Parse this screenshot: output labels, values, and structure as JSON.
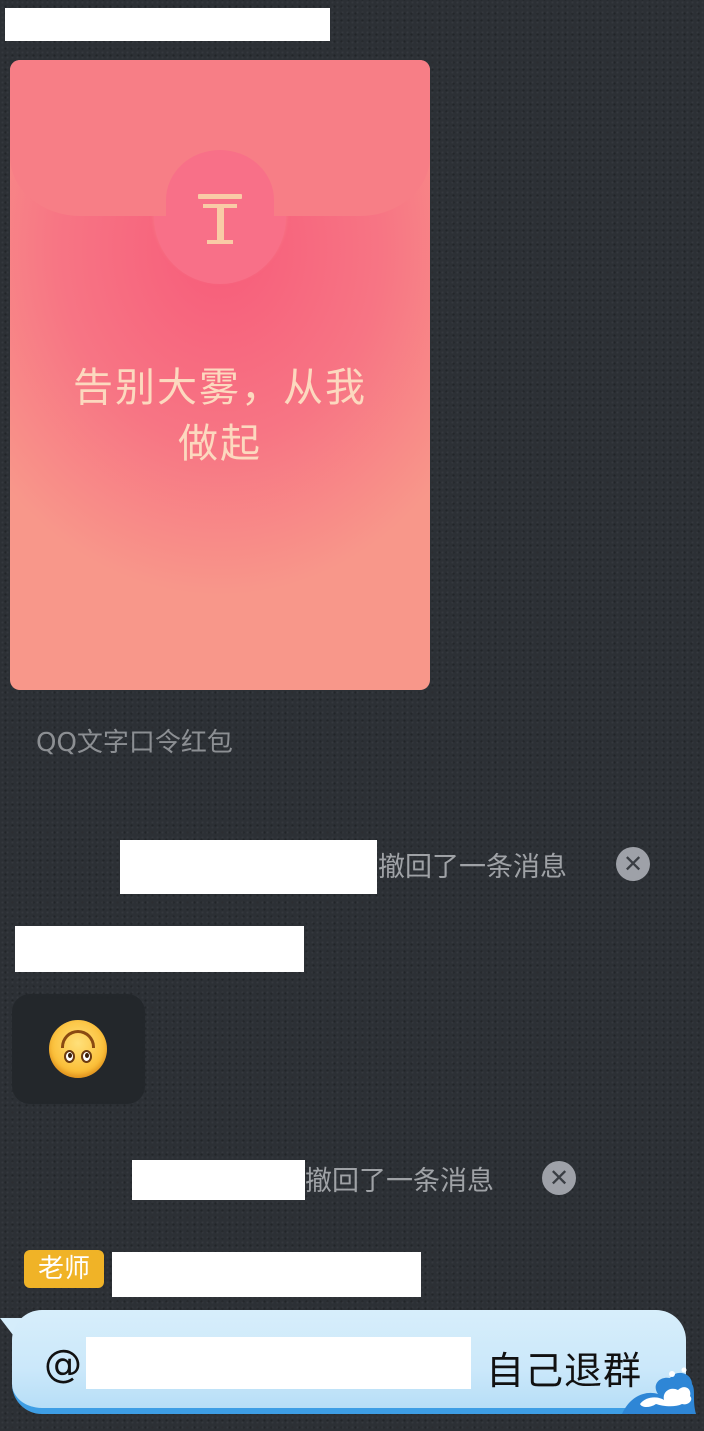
{
  "red_packet": {
    "message_line1": "告别大雾，从我",
    "message_line2": "做起",
    "caption": "QQ文字口令红包",
    "colors": {
      "body": "#f77584",
      "text": "#fcd9bf"
    }
  },
  "system_messages": [
    {
      "text": "撤回了一条消息",
      "dismiss_icon": "close-circle-icon"
    },
    {
      "text": "撤回了一条消息",
      "dismiss_icon": "close-circle-icon"
    }
  ],
  "emoji_message": {
    "icon": "upside-down-face-icon"
  },
  "sender": {
    "badge": "老师"
  },
  "last_message": {
    "at_symbol": "@",
    "text": "自己退群"
  },
  "background_color": "#2c3035"
}
